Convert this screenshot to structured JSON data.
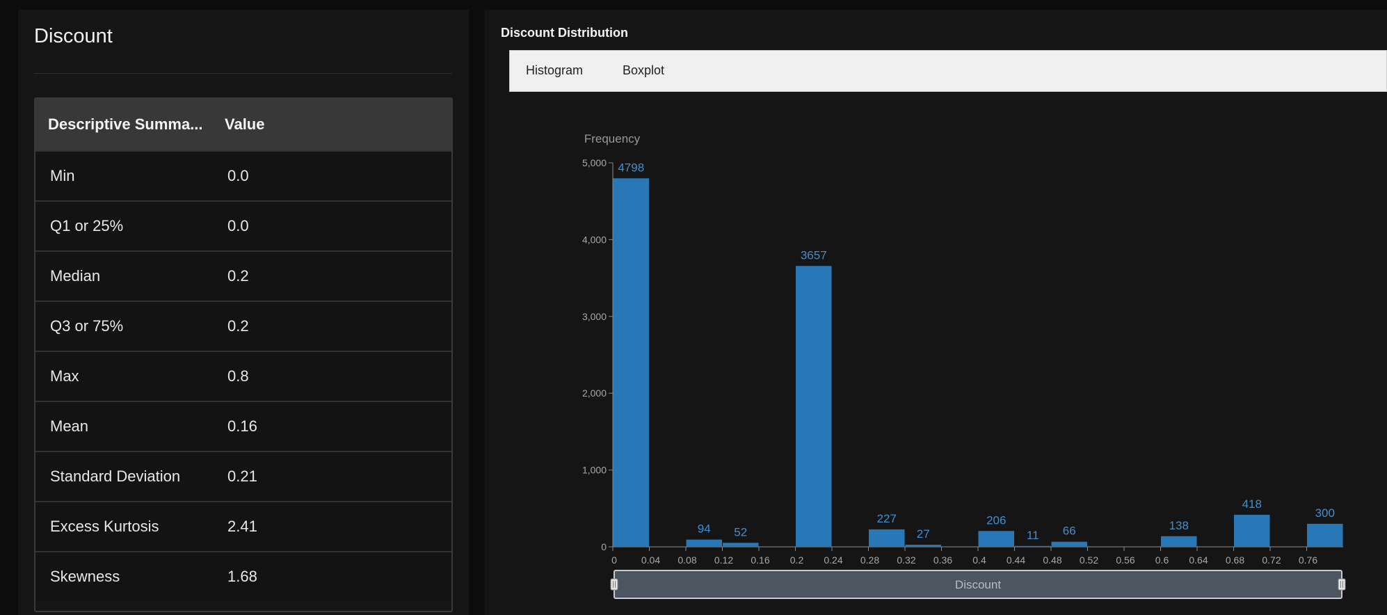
{
  "left": {
    "title": "Discount",
    "table": {
      "headers": [
        "Descriptive Summa...",
        "Value"
      ],
      "rows": [
        {
          "label": "Min",
          "value": "0.0"
        },
        {
          "label": "Q1 or 25%",
          "value": "0.0"
        },
        {
          "label": "Median",
          "value": "0.2"
        },
        {
          "label": "Q3 or 75%",
          "value": "0.2"
        },
        {
          "label": "Max",
          "value": "0.8"
        },
        {
          "label": "Mean",
          "value": "0.16"
        },
        {
          "label": "Standard Deviation",
          "value": "0.21"
        },
        {
          "label": "Excess Kurtosis",
          "value": "2.41"
        },
        {
          "label": "Skewness",
          "value": "1.68"
        }
      ]
    }
  },
  "right": {
    "title": "Discount Distribution",
    "tabs": [
      "Histogram",
      "Boxplot"
    ]
  },
  "chart_data": {
    "type": "bar",
    "ylabel": "Frequency",
    "xlabel": "Discount",
    "bar_color": "#2878b8",
    "ylim": [
      0,
      5000
    ],
    "yticks": [
      0,
      1000,
      2000,
      3000,
      4000,
      5000
    ],
    "ytick_labels": [
      "0",
      "1,000",
      "2,000",
      "3,000",
      "4,000",
      "5,000"
    ],
    "xlim": [
      0,
      0.8
    ],
    "xticks": [
      "0",
      "0.04",
      "0.08",
      "0.12",
      "0.16",
      "0.2",
      "0.24",
      "0.28",
      "0.32",
      "0.36",
      "0.4",
      "0.44",
      "0.48",
      "0.52",
      "0.56",
      "0.6",
      "0.64",
      "0.68",
      "0.72",
      "0.76"
    ],
    "bins": [
      {
        "x0": 0.0,
        "x1": 0.04,
        "value": 4798
      },
      {
        "x0": 0.08,
        "x1": 0.12,
        "value": 94
      },
      {
        "x0": 0.12,
        "x1": 0.16,
        "value": 52
      },
      {
        "x0": 0.2,
        "x1": 0.24,
        "value": 3657
      },
      {
        "x0": 0.28,
        "x1": 0.32,
        "value": 227
      },
      {
        "x0": 0.32,
        "x1": 0.36,
        "value": 27
      },
      {
        "x0": 0.4,
        "x1": 0.44,
        "value": 206
      },
      {
        "x0": 0.44,
        "x1": 0.48,
        "value": 11
      },
      {
        "x0": 0.48,
        "x1": 0.52,
        "value": 66
      },
      {
        "x0": 0.6,
        "x1": 0.64,
        "value": 138
      },
      {
        "x0": 0.68,
        "x1": 0.72,
        "value": 418
      },
      {
        "x0": 0.76,
        "x1": 0.8,
        "value": 300
      }
    ]
  }
}
